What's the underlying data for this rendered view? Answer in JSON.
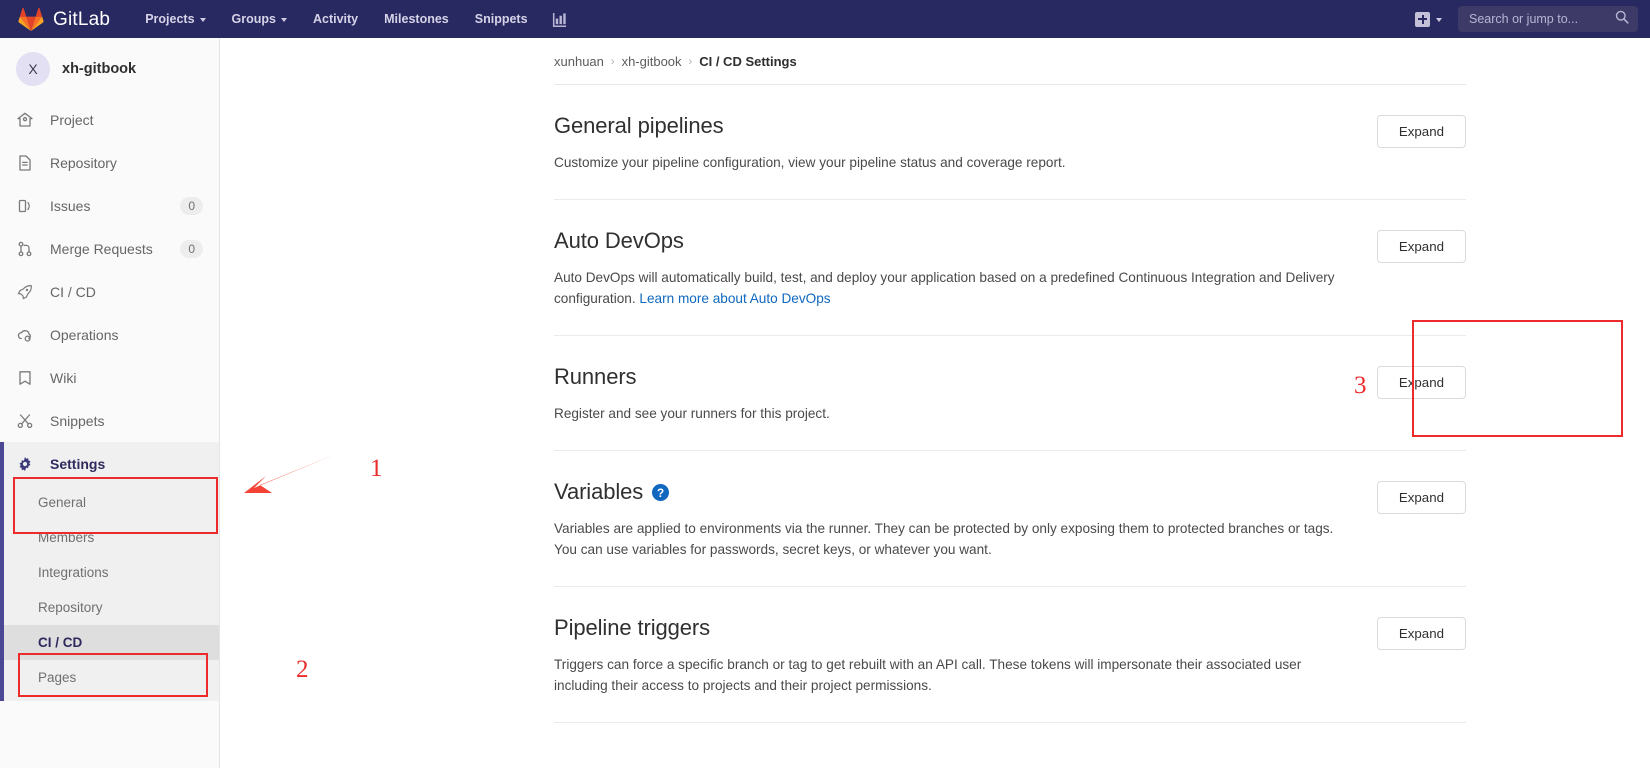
{
  "navbar": {
    "brand": "GitLab",
    "brand_icon": "gitlab-logo-icon",
    "links": [
      {
        "label": "Projects",
        "has_caret": true,
        "name": "nav-link-projects"
      },
      {
        "label": "Groups",
        "has_caret": true,
        "name": "nav-link-groups"
      },
      {
        "label": "Activity",
        "has_caret": false,
        "name": "nav-link-activity"
      },
      {
        "label": "Milestones",
        "has_caret": false,
        "name": "nav-link-milestones"
      },
      {
        "label": "Snippets",
        "has_caret": false,
        "name": "nav-link-snippets"
      }
    ],
    "chart_icon": "bar-chart-icon",
    "plus_icon": "plus-square-icon",
    "plus_caret_icon": "chevron-down-icon",
    "search": {
      "placeholder": "Search or jump to...",
      "value": "",
      "icon": "search-icon"
    }
  },
  "sidebar": {
    "project": {
      "avatar_initial": "X",
      "name": "xh-gitbook"
    },
    "items": [
      {
        "label": "Project",
        "icon": "home-icon",
        "badge": ""
      },
      {
        "label": "Repository",
        "icon": "document-icon",
        "badge": ""
      },
      {
        "label": "Issues",
        "icon": "issues-icon",
        "badge": "0"
      },
      {
        "label": "Merge Requests",
        "icon": "merge-request-icon",
        "badge": "0"
      },
      {
        "label": "CI / CD",
        "icon": "rocket-icon",
        "badge": ""
      },
      {
        "label": "Operations",
        "icon": "operations-icon",
        "badge": ""
      },
      {
        "label": "Wiki",
        "icon": "book-icon",
        "badge": ""
      },
      {
        "label": "Snippets",
        "icon": "scissors-icon",
        "badge": ""
      }
    ],
    "settings": {
      "label": "Settings",
      "icon": "gear-icon",
      "active": true,
      "submenu": [
        {
          "label": "General",
          "active": false
        },
        {
          "label": "Members",
          "active": false
        },
        {
          "label": "Integrations",
          "active": false
        },
        {
          "label": "Repository",
          "active": false
        },
        {
          "label": "CI / CD",
          "active": true
        },
        {
          "label": "Pages",
          "active": false
        }
      ]
    }
  },
  "breadcrumb": {
    "group": "xunhuan",
    "project": "xh-gitbook",
    "current": "CI / CD Settings",
    "separator": "›"
  },
  "settings_sections": [
    {
      "title": "General pipelines",
      "help_icon": false,
      "description": "Customize your pipeline configuration, view your pipeline status and coverage report.",
      "link_text": "",
      "description_tail": "",
      "button": "Expand"
    },
    {
      "title": "Auto DevOps",
      "help_icon": false,
      "description": "Auto DevOps will automatically build, test, and deploy your application based on a predefined Continuous Integration and Delivery configuration. ",
      "link_text": "Learn more about Auto DevOps",
      "description_tail": "",
      "button": "Expand"
    },
    {
      "title": "Runners",
      "help_icon": false,
      "description": "Register and see your runners for this project.",
      "link_text": "",
      "description_tail": "",
      "button": "Expand"
    },
    {
      "title": "Variables",
      "help_icon": true,
      "help_icon_name": "question-mark-help-icon",
      "description": "Variables are applied to environments via the runner. They can be protected by only exposing them to protected branches or tags. You can use variables for passwords, secret keys, or whatever you want.",
      "link_text": "",
      "description_tail": "",
      "button": "Expand"
    },
    {
      "title": "Pipeline triggers",
      "help_icon": false,
      "description": "Triggers can force a specific branch or tag to get rebuilt with an API call. These tokens will impersonate their associated user including their access to projects and their project permissions.",
      "link_text": "",
      "description_tail": "",
      "button": "Expand"
    }
  ],
  "annotations": {
    "marker_1": "1",
    "marker_2": "2",
    "marker_3": "3",
    "color": "#ee2b2b"
  },
  "colors": {
    "navbar_bg": "#292961",
    "accent_purple": "#4c4795",
    "link_blue": "#1068bf",
    "annotation_red": "#ee2b2b",
    "gitlab_orange": "#e24329"
  }
}
